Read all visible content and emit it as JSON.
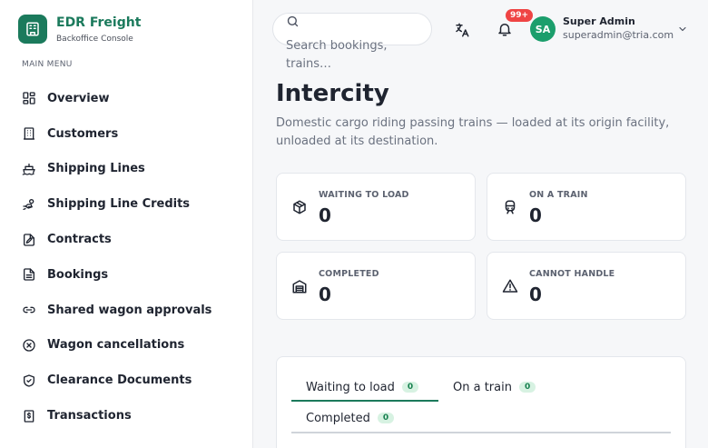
{
  "brand": {
    "name": "EDR Freight",
    "subtitle": "Backoffice Console",
    "color": "#1b7a5c"
  },
  "sidebar": {
    "menu_label": "MAIN MENU",
    "items": [
      {
        "label": "Overview",
        "icon": "grid-icon"
      },
      {
        "label": "Customers",
        "icon": "building-icon"
      },
      {
        "label": "Shipping Lines",
        "icon": "ship-icon"
      },
      {
        "label": "Shipping Line Credits",
        "icon": "hand-coins-icon"
      },
      {
        "label": "Contracts",
        "icon": "file-signature-icon"
      },
      {
        "label": "Bookings",
        "icon": "file-text-icon"
      },
      {
        "label": "Shared wagon approvals",
        "icon": "link-icon"
      },
      {
        "label": "Wagon cancellations",
        "icon": "x-circle-icon"
      },
      {
        "label": "Clearance Documents",
        "icon": "shield-check-icon"
      },
      {
        "label": "Transactions",
        "icon": "dollar-receipt-icon"
      }
    ]
  },
  "topbar": {
    "search_placeholder": "Search bookings, trains…",
    "notification_badge": "99+",
    "user": {
      "initials": "SA",
      "name": "Super Admin",
      "email": "superadmin@tria.com"
    }
  },
  "page": {
    "title": "Intercity",
    "description": "Domestic cargo riding passing trains — loaded at its origin facility, unloaded at its destination."
  },
  "stats": [
    {
      "label": "WAITING TO LOAD",
      "value": "0",
      "icon": "package-icon"
    },
    {
      "label": "ON A TRAIN",
      "value": "0",
      "icon": "train-icon"
    },
    {
      "label": "COMPLETED",
      "value": "0",
      "icon": "warehouse-icon"
    },
    {
      "label": "CANNOT HANDLE",
      "value": "0",
      "icon": "warning-icon"
    }
  ],
  "tabs": [
    {
      "label": "Waiting to load",
      "count": "0",
      "active": true
    },
    {
      "label": "On a train",
      "count": "0",
      "active": false
    },
    {
      "label": "Completed",
      "count": "0",
      "active": false
    }
  ]
}
